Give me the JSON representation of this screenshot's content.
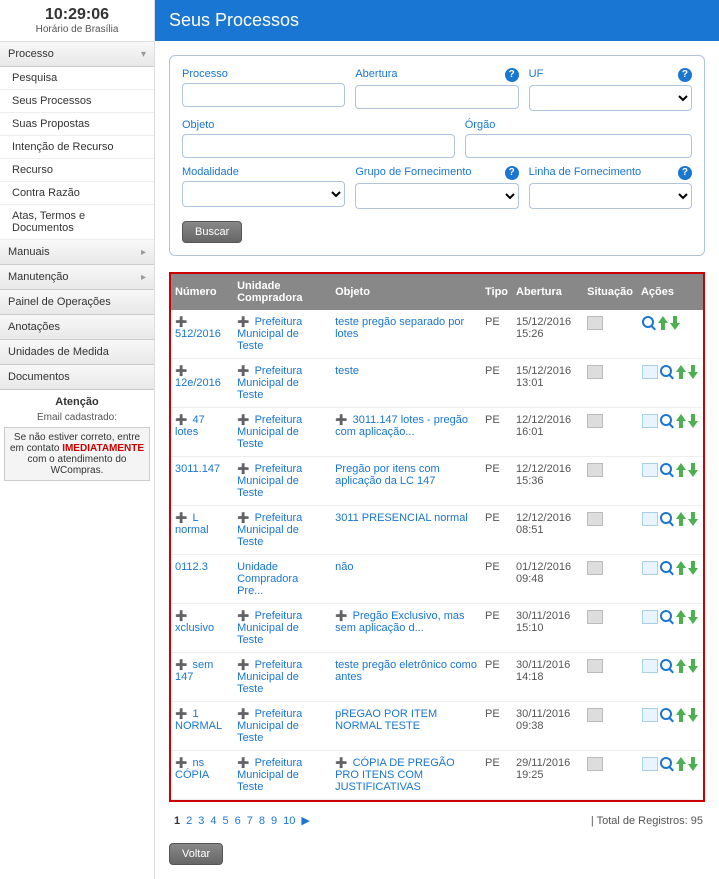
{
  "clock": {
    "time": "10:29:06",
    "timezone": "Horário de Brasília"
  },
  "sidebar": {
    "processo": {
      "label": "Processo",
      "items": [
        "Pesquisa",
        "Seus Processos",
        "Suas Propostas",
        "Intenção de Recurso",
        "Recurso",
        "Contra Razão",
        "Atas, Termos e Documentos"
      ]
    },
    "manuais": {
      "label": "Manuais"
    },
    "manutencao": {
      "label": "Manutenção"
    },
    "painel": {
      "label": "Painel de Operações"
    },
    "anotacoes": {
      "label": "Anotações"
    },
    "unidades": {
      "label": "Unidades de Medida"
    },
    "documentos": {
      "label": "Documentos"
    },
    "attention": {
      "title": "Atenção",
      "email_label": "Email cadastrado:",
      "note_before": "Se não estiver correto, entre em contato ",
      "note_hl": "IMEDIATAMENTE",
      "note_after": " com o atendimento do WCompras."
    }
  },
  "page": {
    "title": "Seus Processos"
  },
  "filters": {
    "processo": "Processo",
    "abertura": "Abertura",
    "uf": "UF",
    "objeto": "Objeto",
    "orgao": "Órgão",
    "modalidade": "Modalidade",
    "grupo": "Grupo de Fornecimento",
    "linha": "Linha de Fornecimento",
    "buscar": "Buscar"
  },
  "table": {
    "headers": {
      "numero": "Número",
      "unidade": "Unidade Compradora",
      "objeto": "Objeto",
      "tipo": "Tipo",
      "abertura": "Abertura",
      "situacao": "Situação",
      "acoes": "Ações"
    },
    "rows": [
      {
        "numero": "512/2016",
        "expand": true,
        "unidade": "Prefeitura Municipal de Teste",
        "uexpand": true,
        "objeto": "teste pregão separado por lotes",
        "tipo": "PE",
        "abertura": "15/12/2016 15:26",
        "status": "doc",
        "paper": false
      },
      {
        "numero": "12e/2016",
        "expand": true,
        "unidade": "Prefeitura Municipal de Teste",
        "uexpand": true,
        "objeto": "teste",
        "tipo": "PE",
        "abertura": "15/12/2016 13:01",
        "status": "doc",
        "paper": true
      },
      {
        "numero": "47 lotes",
        "expand": true,
        "unidade": "Prefeitura Municipal de Teste",
        "uexpand": true,
        "objeto": "3011.147 lotes - pregão com aplicação...",
        "oexpand": true,
        "tipo": "PE",
        "abertura": "12/12/2016 16:01",
        "status": "doc",
        "paper": true
      },
      {
        "numero": "3011.147",
        "expand": false,
        "unidade": "Prefeitura Municipal de Teste",
        "uexpand": true,
        "objeto": "Pregão por itens com aplicação da LC 147",
        "tipo": "PE",
        "abertura": "12/12/2016 15:36",
        "status": "doc",
        "paper": true
      },
      {
        "numero": "L normal",
        "expand": true,
        "unidade": "Prefeitura Municipal de Teste",
        "uexpand": true,
        "objeto": "3011 PRESENCIAL normal",
        "tipo": "PE",
        "abertura": "12/12/2016 08:51",
        "status": "card",
        "paper": true
      },
      {
        "numero": "0112.3",
        "expand": false,
        "unidade": "Unidade Compradora Pre...",
        "uexpand": false,
        "objeto": "não",
        "tipo": "PE",
        "abertura": "01/12/2016 09:48",
        "status": "doc",
        "paper": true
      },
      {
        "numero": "xclusivo",
        "expand": true,
        "unidade": "Prefeitura Municipal de Teste",
        "uexpand": true,
        "objeto": "Pregão Exclusivo, mas sem aplicação d...",
        "oexpand": true,
        "tipo": "PE",
        "abertura": "30/11/2016 15:10",
        "status": "doc",
        "paper": true
      },
      {
        "numero": "sem 147",
        "expand": true,
        "unidade": "Prefeitura Municipal de Teste",
        "uexpand": true,
        "objeto": "teste pregão eletrônico como antes",
        "tipo": "PE",
        "abertura": "30/11/2016 14:18",
        "status": "doc",
        "paper": true
      },
      {
        "numero": "1 NORMAL",
        "expand": true,
        "unidade": "Prefeitura Municipal de Teste",
        "uexpand": true,
        "objeto": "pREGAO POR ITEM NORMAL TESTE",
        "tipo": "PE",
        "abertura": "30/11/2016 09:38",
        "status": "doc",
        "paper": true
      },
      {
        "numero": "ns CÓPIA",
        "expand": true,
        "unidade": "Prefeitura Municipal de Teste",
        "uexpand": true,
        "objeto": "CÓPIA DE PREGÃO PRO ITENS COM JUSTIFICATIVAS",
        "oexpand": true,
        "tipo": "PE",
        "abertura": "29/11/2016 19:25",
        "status": "doc",
        "paper": true
      }
    ]
  },
  "pagination": {
    "pages": [
      "1",
      "2",
      "3",
      "4",
      "5",
      "6",
      "7",
      "8",
      "9",
      "10"
    ],
    "next": "▶",
    "total_label": "| Total de Registros:",
    "total": "95"
  },
  "voltar": "Voltar"
}
